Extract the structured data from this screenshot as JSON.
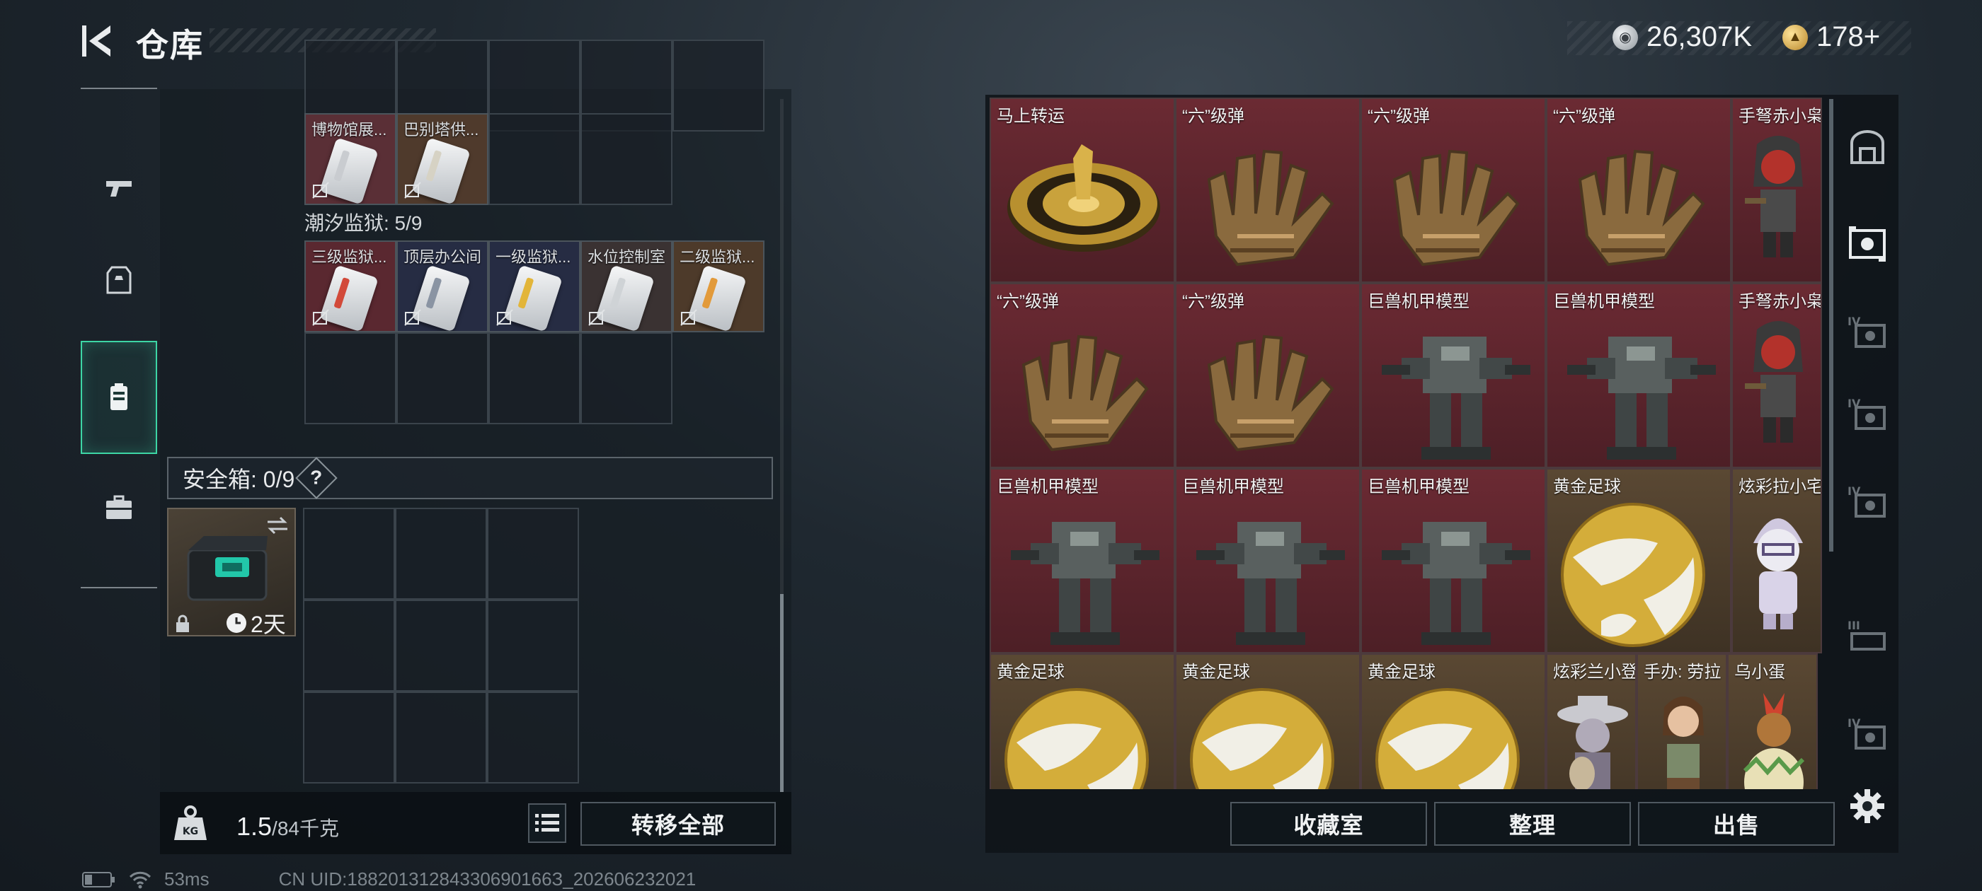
{
  "header": {
    "title": "仓库",
    "currency": [
      {
        "icon": "silver-coin-icon",
        "amount": "26,307K"
      },
      {
        "icon": "gold-coin-icon",
        "amount": "178+"
      }
    ]
  },
  "left_nav": [
    {
      "icon": "pistol-icon",
      "active": false
    },
    {
      "icon": "armor-vest-icon",
      "active": false
    },
    {
      "icon": "backpack-icon",
      "active": true
    },
    {
      "icon": "briefcase-icon",
      "active": false
    }
  ],
  "backpack": {
    "top_items": [
      {
        "label": "博物馆展...",
        "color": "#c9ccd0"
      },
      {
        "label": "巴别塔供...",
        "color": "#d6d2c4"
      }
    ],
    "section_label": "潮汐监狱: 5/9",
    "section_items": [
      {
        "label": "三级监狱...",
        "color": "#d24a3a",
        "bg": "#5a2830"
      },
      {
        "label": "顶层办公间",
        "color": "#8a94a3",
        "bg": "#262c43"
      },
      {
        "label": "一级监狱...",
        "color": "#e2b53a",
        "bg": "#262c43"
      },
      {
        "label": "水位控制室",
        "color": "#cfd3d6",
        "bg": "#3a3232"
      },
      {
        "label": "二级监狱...",
        "color": "#e29a3a",
        "bg": "#4d3a2a"
      }
    ]
  },
  "safebox": {
    "label": "安全箱: 0/9",
    "help": "?",
    "item_timer": "2天"
  },
  "footer_left": {
    "weight_value": "1.5",
    "weight_capacity": "/84千克",
    "transfer_all": "转移全部"
  },
  "status": {
    "ping": "53ms",
    "uid": "CN UID:18820131284330690166З_202606232021"
  },
  "items": [
    {
      "label": "马上转运",
      "art": "medallion"
    },
    {
      "label": "“六”级弹",
      "art": "glove"
    },
    {
      "label": "“六”级弹",
      "art": "glove"
    },
    {
      "label": "“六”级弹",
      "art": "glove"
    },
    {
      "label": "手弩赤小枭",
      "art": "figure-red"
    },
    {
      "label": "“六”级弹",
      "art": "glove"
    },
    {
      "label": "“六”级弹",
      "art": "glove"
    },
    {
      "label": "巨兽机甲模型",
      "art": "mech"
    },
    {
      "label": "巨兽机甲模型",
      "art": "mech"
    },
    {
      "label": "手弩赤小枭",
      "art": "figure-red"
    },
    {
      "label": "巨兽机甲模型",
      "art": "mech"
    },
    {
      "label": "巨兽机甲模型",
      "art": "mech"
    },
    {
      "label": "巨兽机甲模型",
      "art": "mech"
    },
    {
      "label": "黄金足球",
      "art": "ball"
    },
    {
      "label": "炫彩拉小宅",
      "art": "figure-white"
    },
    {
      "label": "黄金足球",
      "art": "ball"
    },
    {
      "label": "黄金足球",
      "art": "ball"
    },
    {
      "label": "黄金足球",
      "art": "ball"
    },
    {
      "label": "炫彩兰小登",
      "art": "figure-grey"
    },
    {
      "label": "手办: 劳拉",
      "art": "figure-lara"
    },
    {
      "label": "乌小蛋",
      "art": "figure-egg"
    }
  ],
  "right_nav": [
    {
      "icon": "vault-icon"
    },
    {
      "icon": "display-case-icon"
    },
    {
      "icon": "display-case-iv-icon"
    },
    {
      "icon": "display-case-iv-icon"
    },
    {
      "icon": "display-case-iv-icon"
    },
    {
      "icon": "display-case-iii-icon"
    },
    {
      "icon": "display-case-iv-icon"
    }
  ],
  "footer_right": {
    "collection_room": "收藏室",
    "sort": "整理",
    "sell": "出售"
  }
}
